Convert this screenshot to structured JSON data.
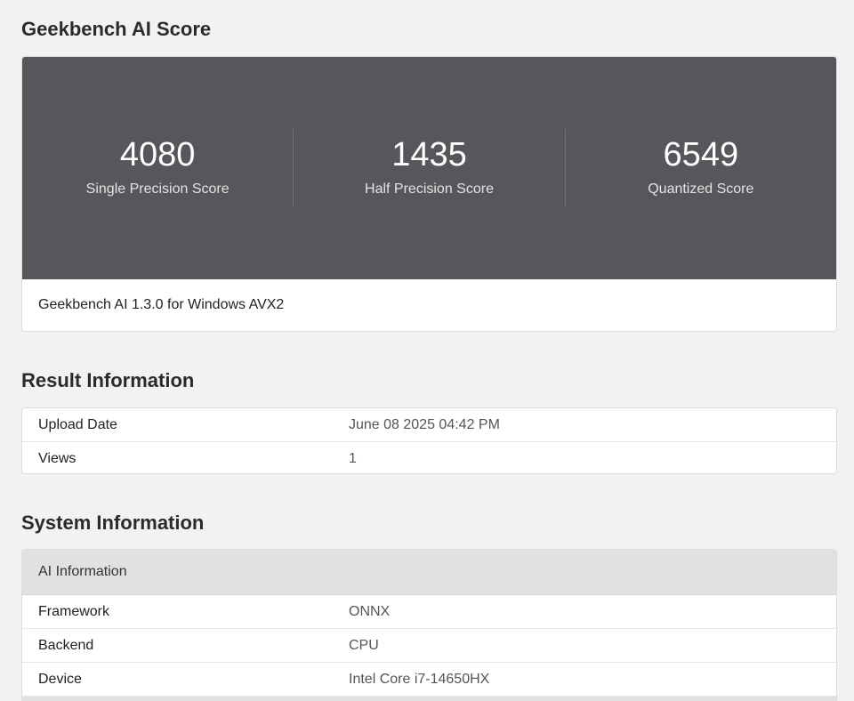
{
  "score_section": {
    "title": "Geekbench AI Score",
    "scores": [
      {
        "value": "4080",
        "label": "Single Precision Score"
      },
      {
        "value": "1435",
        "label": "Half Precision Score"
      },
      {
        "value": "6549",
        "label": "Quantized Score"
      }
    ],
    "version_text": "Geekbench AI 1.3.0 for Windows AVX2"
  },
  "result_section": {
    "title": "Result Information",
    "rows": [
      {
        "key": "Upload Date",
        "value": "June 08 2025 04:42 PM"
      },
      {
        "key": "Views",
        "value": "1"
      }
    ]
  },
  "system_section": {
    "title": "System Information",
    "group_title": "AI Information",
    "rows": [
      {
        "key": "Framework",
        "value": "ONNX"
      },
      {
        "key": "Backend",
        "value": "CPU"
      },
      {
        "key": "Device",
        "value": "Intel Core i7-14650HX"
      }
    ]
  },
  "colors": {
    "page_background": "#f2f2f2",
    "score_panel": "#56575b",
    "group_header": "#e1e1e1"
  }
}
